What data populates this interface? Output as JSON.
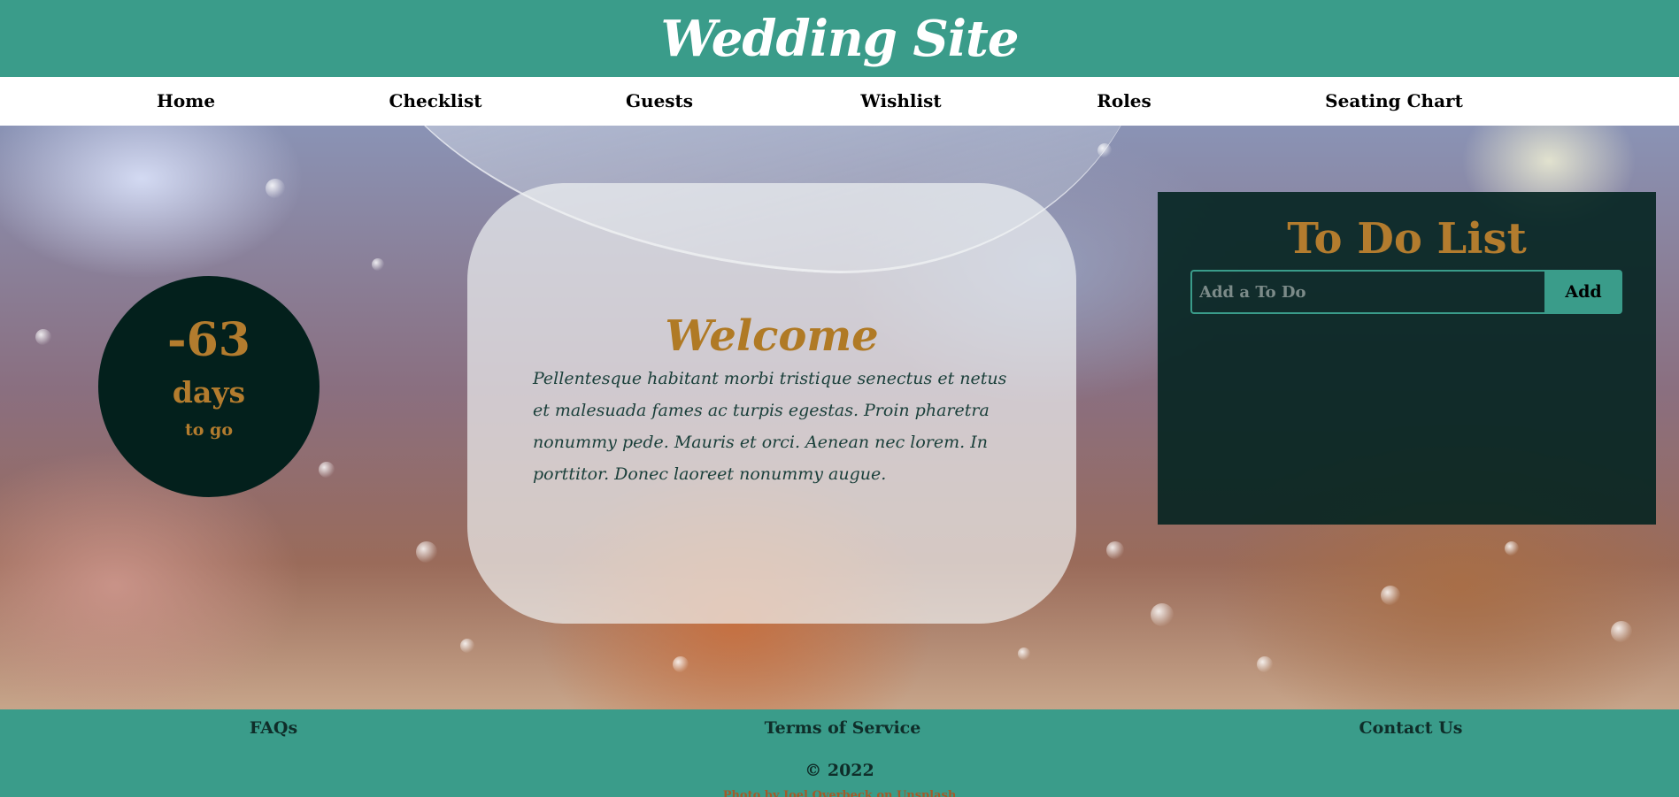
{
  "header": {
    "title": "Wedding Site"
  },
  "nav": {
    "items": [
      {
        "label": "Home"
      },
      {
        "label": "Checklist"
      },
      {
        "label": "Guests"
      },
      {
        "label": "Wishlist"
      },
      {
        "label": "Roles"
      },
      {
        "label": "Seating Chart"
      }
    ]
  },
  "countdown": {
    "value": "-63",
    "unit": "days",
    "suffix": "to go"
  },
  "welcome": {
    "title": "Welcome",
    "body": "Pellentesque habitant morbi tristique senectus et netus et malesuada fames ac turpis egestas. Proin pharetra nonummy pede. Mauris et orci. Aenean nec lorem. In porttitor. Donec laoreet nonummy augue."
  },
  "todo": {
    "title": "To Do List",
    "input_placeholder": "Add a To Do",
    "input_value": "",
    "add_label": "Add"
  },
  "footer": {
    "links": [
      {
        "label": "FAQs"
      },
      {
        "label": "Terms of Service"
      },
      {
        "label": "Contact Us"
      }
    ],
    "copyright": "© 2022",
    "credit": "Photo by Joel Overbeck on Unsplash"
  },
  "colors": {
    "brand": "#3a9c8a",
    "accent": "#b37c2e",
    "dark": "#03201c"
  }
}
